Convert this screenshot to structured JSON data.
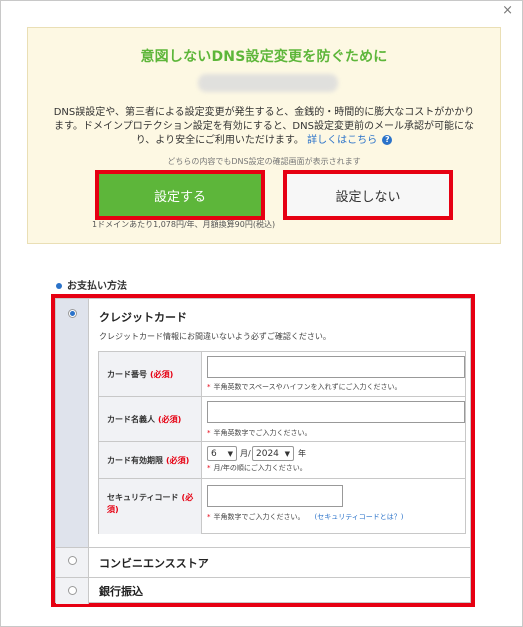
{
  "close_glyph": "×",
  "promo": {
    "title": "意図しないDNS設定変更を防ぐために",
    "desc_line1": "DNS誤設定や、第三者による設定変更が発生すると、金銭的・時間的に膨大なコストがかかり",
    "desc_line2": "ます。ドメインプロテクション設定を有効にすると、DNS設定変更前のメール承認が可能にな",
    "desc_line3": "り、より安全にご利用いただけます。",
    "more_link": "詳しくはこちら",
    "help_glyph": "?",
    "note": "どちらの内容でもDNS設定の確認画面が表示されます",
    "set_button": "設定する",
    "noset_button": "設定しない",
    "price": "1ドメインあたり1,078円/年、月額換算90円(税込)"
  },
  "payment": {
    "heading": "お支払い方法",
    "options": [
      {
        "label": "クレジットカード",
        "selected": true
      },
      {
        "label": "コンビニエンスストア",
        "selected": false
      },
      {
        "label": "銀行振込",
        "selected": false
      }
    ],
    "cc_note": "クレジットカード情報にお間違いないよう必ずご確認ください。",
    "required": "(必須)",
    "hint_mark": "*",
    "fields": {
      "card_number": {
        "label": "カード番号",
        "hint": "半角英数でスペースやハイフンを入れずにご入力ください。"
      },
      "card_name": {
        "label": "カード名義人",
        "hint": "半角英数字でご入力ください。"
      },
      "expiry": {
        "label": "カード有効期限",
        "month": "6",
        "month_unit": "月/",
        "year": "2024",
        "year_unit": "年",
        "hint": "月/年の順にご入力ください。"
      },
      "security": {
        "label": "セキュリティコード",
        "hint": "半角数字でご入力ください。",
        "link": "(セキュリティコードとは？)"
      }
    }
  },
  "colors": {
    "accent_green": "#5db63a",
    "highlight_red": "#e60012",
    "link_blue": "#2a72c9"
  }
}
